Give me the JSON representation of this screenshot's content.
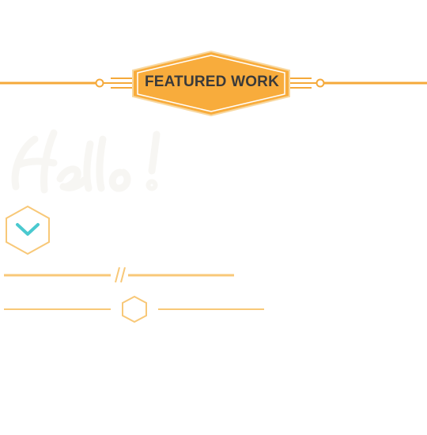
{
  "banner": {
    "label": "FEATURED WORK"
  },
  "colors": {
    "accent": "#f8ac3c",
    "accent_line": "#f5a93a",
    "accent_soft": "#f8c878",
    "badge_border": "#f8d8a0",
    "text_dark": "#3a3a3a",
    "chevron": "#4ac9cf",
    "hello_fill": "#f7f6f3"
  },
  "icons": {
    "scroll_down": "chevron-down-icon",
    "divider_hexagon": "hexagon-icon",
    "divider_slash": "double-slash-icon"
  }
}
